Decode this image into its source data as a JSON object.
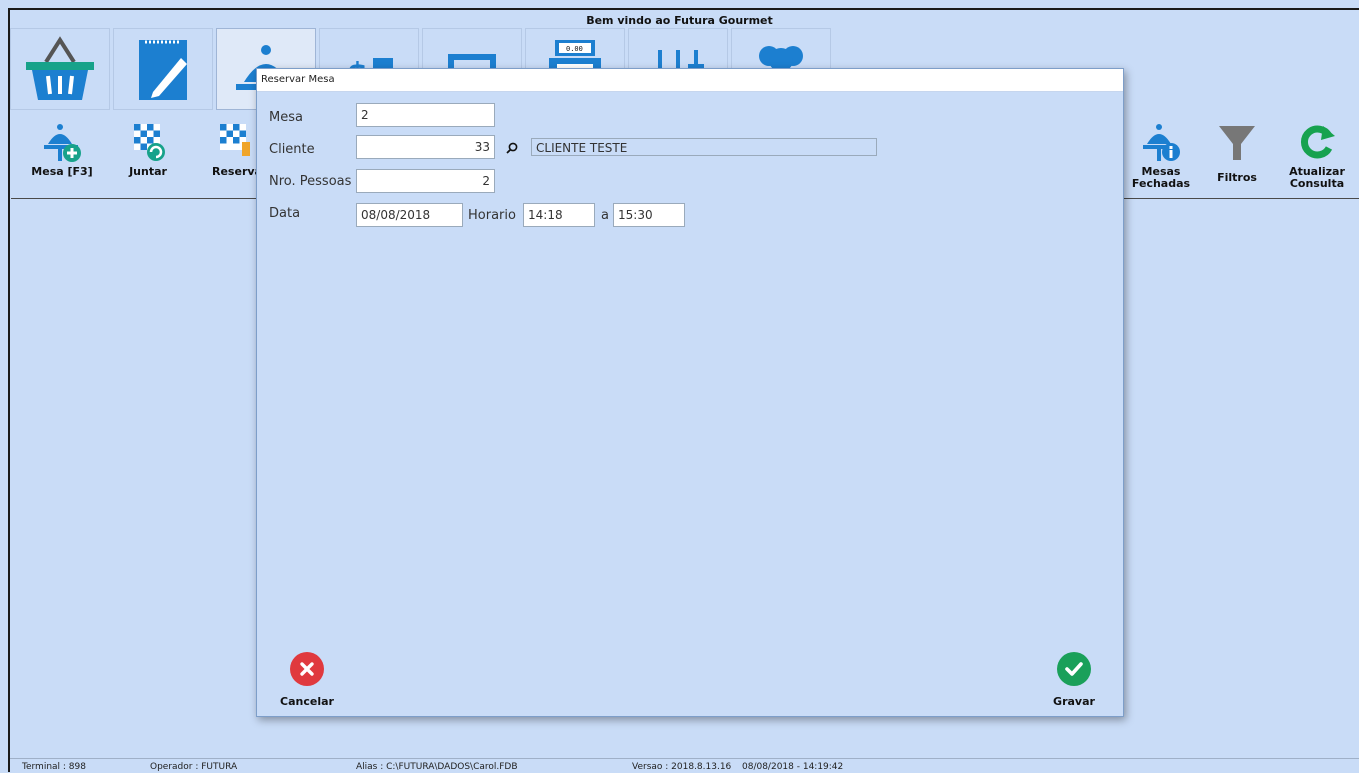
{
  "app": {
    "title": "Bem vindo ao Futura Gourmet"
  },
  "main_tabs": [
    {
      "icon": "basket-icon"
    },
    {
      "icon": "notepad-icon"
    },
    {
      "icon": "waiter-tray-icon"
    },
    {
      "icon": "money-hand-icon"
    },
    {
      "icon": "picture-icon"
    },
    {
      "icon": "cash-register-icon"
    },
    {
      "icon": "sliders-icon"
    },
    {
      "icon": "users-icon"
    }
  ],
  "actions": {
    "mesa": "Mesa [F3]",
    "juntar": "Juntar",
    "reservar": "Reservar",
    "mesas_fechadas": [
      "Mesas",
      "Fechadas"
    ],
    "filtros": "Filtros",
    "atualizar": [
      "Atualizar",
      "Consulta"
    ]
  },
  "dialog": {
    "title": "Reservar Mesa",
    "mesa_label": "Mesa",
    "mesa_value": "2",
    "cliente_label": "Cliente",
    "cliente_code": "33",
    "cliente_name": "CLIENTE TESTE",
    "pessoas_label": "Nro. Pessoas",
    "pessoas_value": "2",
    "data_label": "Data",
    "data_value": "08/08/2018",
    "horario_label": "Horario",
    "horario_inicio": "14:18",
    "a_label": "a",
    "horario_fim": "15:30",
    "cancel_label": "Cancelar",
    "save_label": "Gravar"
  },
  "status": {
    "terminal": "Terminal : 898",
    "operador": "Operador : FUTURA",
    "alias": "Alias : C:\\FUTURA\\DADOS\\Carol.FDB",
    "versao": "Versao : 2018.8.13.16",
    "datetime": "08/08/2018 - 14:19:42"
  },
  "colors": {
    "background": "#c9dcf7",
    "cancel": "#e0393e",
    "save": "#1aa05a",
    "accent_teal": "#17a28a"
  }
}
